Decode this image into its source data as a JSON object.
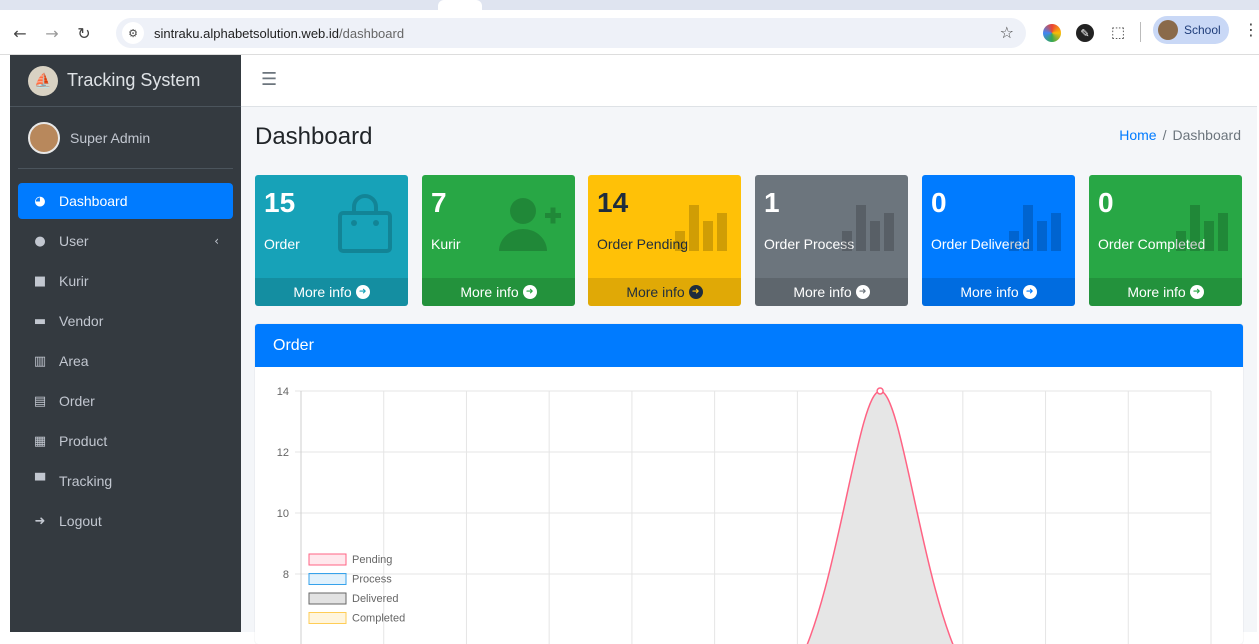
{
  "browser": {
    "url_host": "sintraku.alphabetsolution.web.id",
    "url_path": "/dashboard",
    "profile_name": "School"
  },
  "sidebar": {
    "brand": "Tracking System",
    "user": "Super Admin",
    "items": [
      {
        "label": "Dashboard",
        "icon": "tachometer-icon",
        "active": true
      },
      {
        "label": "User",
        "icon": "user-icon"
      },
      {
        "label": "Kurir",
        "icon": "truck-icon"
      },
      {
        "label": "Vendor",
        "icon": "store-icon"
      },
      {
        "label": "Area",
        "icon": "map-icon"
      },
      {
        "label": "Order",
        "icon": "file-icon"
      },
      {
        "label": "Product",
        "icon": "box-open-icon"
      },
      {
        "label": "Tracking",
        "icon": "archive-icon"
      },
      {
        "label": "Logout",
        "icon": "sign-out-icon"
      }
    ]
  },
  "page": {
    "title": "Dashboard",
    "breadcrumb_home": "Home",
    "breadcrumb_sep": "/",
    "breadcrumb_current": "Dashboard"
  },
  "stats": [
    {
      "value": "15",
      "label": "Order",
      "more": "More info",
      "color": "#17a2b8",
      "icon": "shopping-bag-icon"
    },
    {
      "value": "7",
      "label": "Kurir",
      "more": "More info",
      "color": "#28a745",
      "icon": "user-plus-icon"
    },
    {
      "value": "14",
      "label": "Order Pending",
      "more": "More info",
      "color": "#ffc107",
      "icon": "bar-chart-icon"
    },
    {
      "value": "1",
      "label": "Order Process",
      "more": "More info",
      "color": "#6c757d",
      "icon": "bar-chart-icon"
    },
    {
      "value": "0",
      "label": "Order Delivered",
      "more": "More info",
      "color": "#007bff",
      "icon": "bar-chart-icon"
    },
    {
      "value": "0",
      "label": "Order Completed",
      "more": "More info",
      "color": "#28a745",
      "icon": "bar-chart-icon"
    }
  ],
  "order_card": {
    "title": "Order"
  },
  "chart_data": {
    "type": "line",
    "y_ticks": [
      8,
      10,
      12,
      14
    ],
    "ylim": [
      7,
      14
    ],
    "legend": [
      "Pending",
      "Process",
      "Delivered",
      "Completed"
    ],
    "legend_placement": "left",
    "series": [
      {
        "name": "Pending",
        "peak_value": 14,
        "color": "#ff6384",
        "fill": "#e6e6e6"
      }
    ],
    "grid": true
  }
}
